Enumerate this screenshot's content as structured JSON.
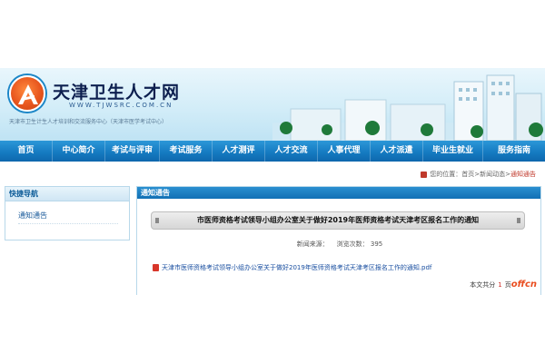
{
  "header": {
    "site_title": "天津卫生人才网",
    "domain": "WWW.TJWSRC.COM.CN",
    "sub_org": "天津市卫生计生人才培训和交流服务中心（天津市医学考试中心）",
    "brand_color": "#1479c0"
  },
  "nav": {
    "items": [
      {
        "label": "首页"
      },
      {
        "label": "中心简介"
      },
      {
        "label": "考试与评审"
      },
      {
        "label": "考试服务"
      },
      {
        "label": "人才测评"
      },
      {
        "label": "人才交流"
      },
      {
        "label": "人事代理"
      },
      {
        "label": "人才派遣"
      },
      {
        "label": "毕业生就业"
      },
      {
        "label": "服务指南"
      }
    ]
  },
  "breadcrumb": {
    "prefix": "您的位置：",
    "items": [
      "首页",
      "新闻动态",
      "通知通告"
    ],
    "separator": " > "
  },
  "sidebar": {
    "title": "快捷导航",
    "items": [
      {
        "label": "通知通告"
      }
    ]
  },
  "main": {
    "panel_title": "通知通告",
    "article_title": "市医师资格考试领导小组办公室关于做好2019年医师资格考试天津考区报名工作的通知",
    "source_label": "新闻来源：",
    "source_value": "",
    "views_label": "浏览次数：",
    "views_value": "395",
    "attachment": "天津市医师资格考试领导小组办公室关于做好2019年医师资格考试天津考区报名工作的通知.pdf",
    "pages_prefix": "本文共分",
    "pages_count": "1",
    "pages_suffix": "页",
    "watermark": "offcn"
  }
}
